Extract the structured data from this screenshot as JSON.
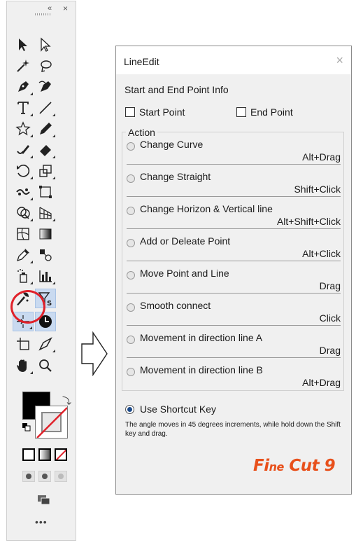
{
  "toolbar": {
    "collapse_label": "«",
    "close_label": "×",
    "more_label": "•••",
    "tools": [
      "selection-tool",
      "direct-selection-tool",
      "magic-wand-tool",
      "lasso-tool",
      "pen-tool",
      "curvature-tool",
      "type-tool",
      "line-segment-tool",
      "shape-tool",
      "pencil-tool",
      "shaper-tool",
      "eraser-tool",
      "rotate-tool",
      "scale-tool",
      "puppet-warp-tool",
      "free-transform-tool",
      "shape-builder-tool",
      "perspective-grid-tool",
      "mesh-tool",
      "gradient-tool",
      "eyedropper-tool",
      "blend-tool",
      "symbol-sprayer-tool",
      "graph-tool",
      "lineedit-plugin-tool",
      "plugin-s-tool",
      "plugin-transform-tool",
      "plugin-clock-tool",
      "artboard-tool",
      "slice-tool",
      "hand-tool",
      "zoom-tool"
    ],
    "selected_tool": "plugin-clock-tool",
    "highlight_color": "#e0212a"
  },
  "panel": {
    "title": "LineEdit",
    "close_label": "×",
    "section_label": "Start and End Point Info",
    "start_point_label": "Start Point",
    "end_point_label": "End Point",
    "action_title": "Action",
    "actions": [
      {
        "label": "Change Curve",
        "shortcut": "Alt+Drag"
      },
      {
        "label": "Change Straight",
        "shortcut": "Shift+Click"
      },
      {
        "label": "Change Horizon & Vertical line",
        "shortcut": "Alt+Shift+Click"
      },
      {
        "label": "Add or Deleate Point",
        "shortcut": "Alt+Click"
      },
      {
        "label": "Move Point and Line",
        "shortcut": "Drag"
      },
      {
        "label": "Smooth connect",
        "shortcut": "Click"
      },
      {
        "label": "Movement in direction line A",
        "shortcut": "Drag"
      },
      {
        "label": "Movement in direction line B",
        "shortcut": "Alt+Drag"
      }
    ],
    "use_shortcut_label": "Use Shortcut Key",
    "use_shortcut_checked": true,
    "note": "The angle moves in 45 degrees increments, while hold down the Shift key and drag.",
    "logo_text": "FineCut9",
    "logo_color": "#e8501b"
  }
}
